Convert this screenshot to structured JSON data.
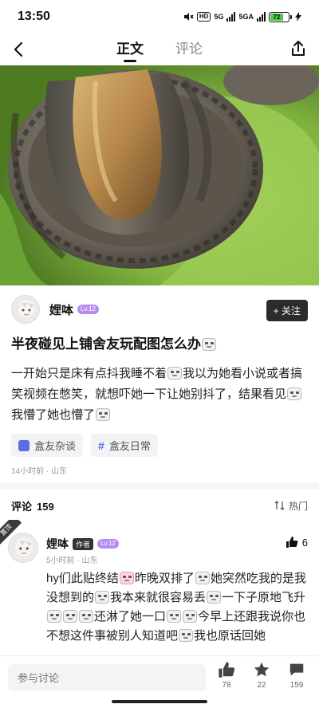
{
  "status_bar": {
    "time": "13:50",
    "hd": "HD",
    "net1": "5G",
    "net2": "5GA",
    "battery": "72"
  },
  "nav": {
    "tabs": [
      "正文",
      "评论"
    ],
    "active_tab": "正文"
  },
  "author": {
    "name": "娌呠",
    "level": "Lv.12",
    "follow_label": "+ 关注"
  },
  "post": {
    "title": "半夜碰见上铺舍友玩配图怎么办",
    "body_parts": [
      "一开始只是床有点抖我睡不着",
      "我以为她看小说或者搞笑视频在憋笑，就想吓她一下让她别抖了，结果看见",
      "我懵了她也懵了"
    ],
    "tags": [
      "盒友杂谈",
      "盒友日常"
    ],
    "meta": "14小时前 · 山东"
  },
  "comments": {
    "label": "评论",
    "count": "159",
    "sort_label": "热门",
    "items": [
      {
        "ribbon": "置顶",
        "name": "娌呠",
        "author_chip": "作者",
        "level": "Lv.12",
        "meta": "5小时前 · 山东",
        "likes": "6",
        "text_parts": [
          "hy们此贴终结",
          "昨晚双排了",
          "她突然吃我的是我没想到的",
          "我本来就很容易丢",
          "一下子原地飞升",
          "还淋了她一口",
          "今早上还跟我说你也不想这件事被别人知道吧",
          "我也原话回她"
        ]
      }
    ]
  },
  "bottom_bar": {
    "input_placeholder": "参与讨论",
    "likes": "78",
    "favorites": "22",
    "comments": "159"
  },
  "colors": {
    "accent_dark": "#2b2b2b",
    "level_badge": "#b58cf0",
    "tag_accent": "#5b6ee1"
  }
}
